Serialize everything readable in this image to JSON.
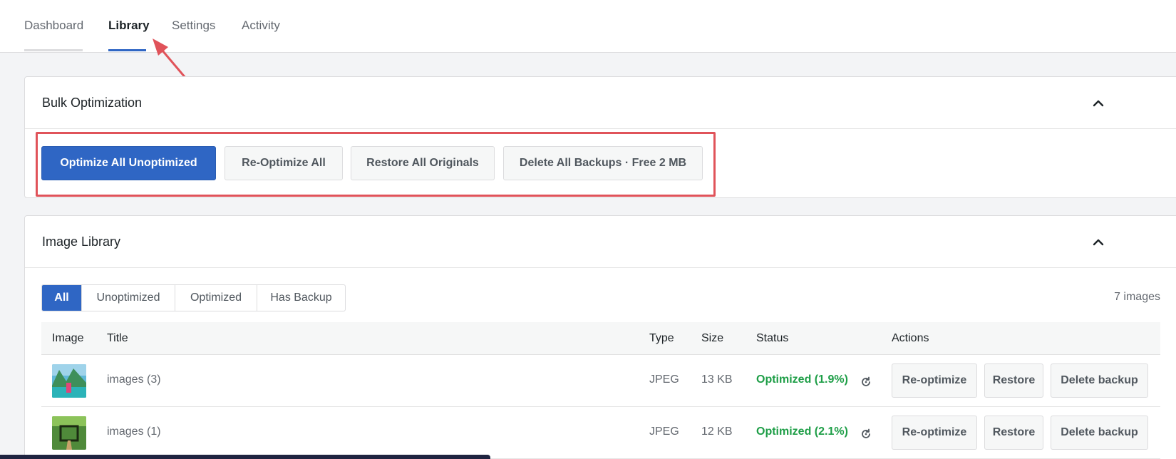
{
  "tabs": [
    {
      "label": "Dashboard"
    },
    {
      "label": "Library"
    },
    {
      "label": "Settings"
    },
    {
      "label": "Activity"
    }
  ],
  "active_tab": "Library",
  "bulk": {
    "title": "Bulk Optimization",
    "buttons": [
      {
        "label": "Optimize All Unoptimized"
      },
      {
        "label": "Re-Optimize All"
      },
      {
        "label": "Restore All Originals"
      },
      {
        "label": "Delete All Backups · Free 2 MB"
      }
    ]
  },
  "library": {
    "title": "Image Library",
    "filters": [
      {
        "label": "All"
      },
      {
        "label": "Unoptimized"
      },
      {
        "label": "Optimized"
      },
      {
        "label": "Has Backup"
      }
    ],
    "active_filter": "All",
    "count": "7 images",
    "columns": [
      "Image",
      "Title",
      "Type",
      "Size",
      "Status",
      "Actions"
    ],
    "rows": [
      {
        "title": "images (3)",
        "type": "JPEG",
        "size": "13 KB",
        "status": "Optimized (1.9%)",
        "actions": [
          "Re-optimize",
          "Restore",
          "Delete backup"
        ]
      },
      {
        "title": "images (1)",
        "type": "JPEG",
        "size": "12 KB",
        "status": "Optimized (2.1%)",
        "actions": [
          "Re-optimize",
          "Restore",
          "Delete backup"
        ]
      }
    ]
  },
  "colors": {
    "primary": "#2f66c4",
    "status_ok": "#1e9e47",
    "annotation": "#e0535a"
  },
  "icons": [
    "chevron-up-icon",
    "refresh-icon",
    "annotation-arrow"
  ]
}
